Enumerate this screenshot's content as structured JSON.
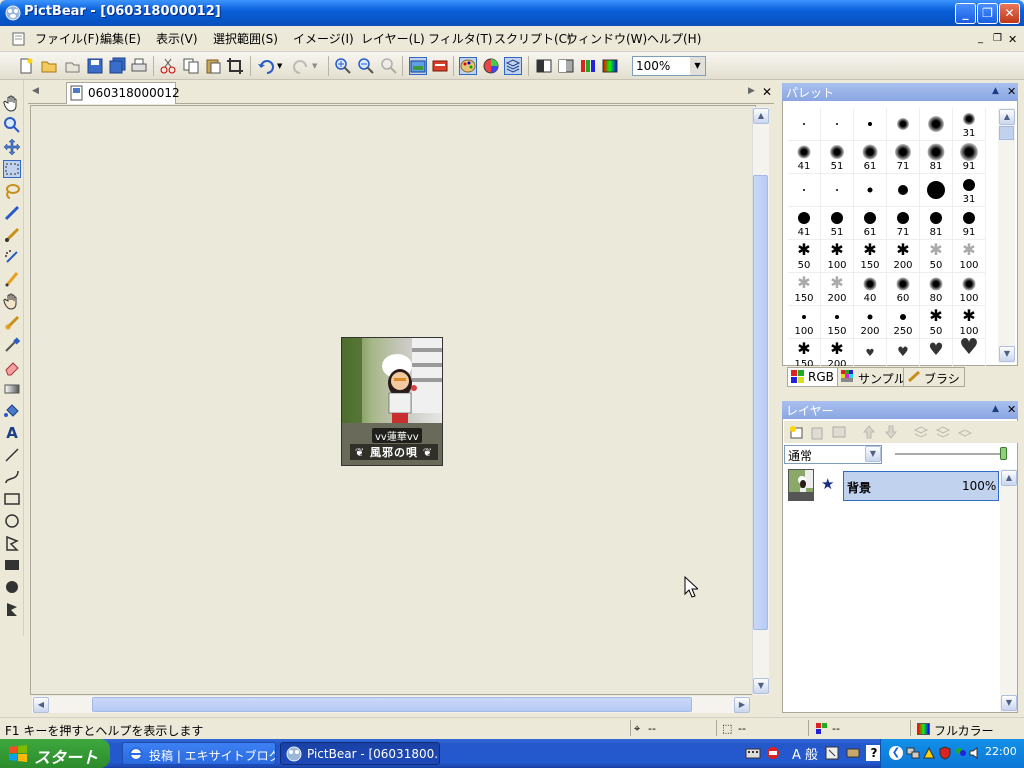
{
  "window": {
    "title": "PictBear - [060318000012]"
  },
  "menu": [
    "ファイル(F)",
    "編集(E)",
    "表示(V)",
    "選択範囲(S)",
    "イメージ(I)",
    "レイヤー(L)",
    "フィルタ(T)",
    "スクリプト(C)",
    "ウィンドウ(W)",
    "ヘルプ(H)"
  ],
  "toolbar": {
    "zoom": "100%"
  },
  "document": {
    "tab": "060318000012"
  },
  "image": {
    "name_tag": "vv蓮華vv",
    "guild_tag": "風邪の唄"
  },
  "palette": {
    "title": "パレット",
    "brushes": [
      {
        "label": "",
        "shape": "dot"
      },
      {
        "label": "",
        "shape": "dot"
      },
      {
        "label": "",
        "shape": "dot"
      },
      {
        "label": "",
        "shape": "soft"
      },
      {
        "label": "",
        "shape": "soft"
      },
      {
        "label": "31",
        "shape": "soft"
      },
      {
        "label": "41",
        "shape": "soft"
      },
      {
        "label": "51",
        "shape": "soft"
      },
      {
        "label": "61",
        "shape": "soft"
      },
      {
        "label": "71",
        "shape": "soft"
      },
      {
        "label": "81",
        "shape": "soft"
      },
      {
        "label": "91",
        "shape": "soft"
      },
      {
        "label": "",
        "shape": "dot"
      },
      {
        "label": "",
        "shape": "dot"
      },
      {
        "label": "",
        "shape": "dot"
      },
      {
        "label": "",
        "shape": "dot"
      },
      {
        "label": "",
        "shape": "dot"
      },
      {
        "label": "31",
        "shape": "dot"
      },
      {
        "label": "41",
        "shape": "dot"
      },
      {
        "label": "51",
        "shape": "dot"
      },
      {
        "label": "61",
        "shape": "dot"
      },
      {
        "label": "71",
        "shape": "dot"
      },
      {
        "label": "81",
        "shape": "dot"
      },
      {
        "label": "91",
        "shape": "dot"
      },
      {
        "label": "50",
        "shape": "star"
      },
      {
        "label": "100",
        "shape": "star"
      },
      {
        "label": "150",
        "shape": "star"
      },
      {
        "label": "200",
        "shape": "star"
      },
      {
        "label": "50",
        "shape": "starlight"
      },
      {
        "label": "100",
        "shape": "starlight"
      },
      {
        "label": "150",
        "shape": "starlight"
      },
      {
        "label": "200",
        "shape": "starlight"
      },
      {
        "label": "40",
        "shape": "soft"
      },
      {
        "label": "60",
        "shape": "soft"
      },
      {
        "label": "80",
        "shape": "soft"
      },
      {
        "label": "100",
        "shape": "soft"
      },
      {
        "label": "100",
        "shape": "dot"
      },
      {
        "label": "150",
        "shape": "dot"
      },
      {
        "label": "200",
        "shape": "dot"
      },
      {
        "label": "250",
        "shape": "dot"
      },
      {
        "label": "50",
        "shape": "star"
      },
      {
        "label": "100",
        "shape": "star"
      },
      {
        "label": "150",
        "shape": "star"
      },
      {
        "label": "200",
        "shape": "star"
      },
      {
        "label": "",
        "shape": "heart"
      },
      {
        "label": "",
        "shape": "heart"
      },
      {
        "label": "",
        "shape": "heart"
      },
      {
        "label": "",
        "shape": "heart"
      }
    ],
    "tabs": [
      "RGB",
      "サンプル",
      "ブラシ"
    ]
  },
  "layers": {
    "title": "レイヤー",
    "blend_mode": "通常",
    "items": [
      {
        "name": "背景",
        "opacity": "100%"
      }
    ]
  },
  "status": {
    "help": "F1 キーを押すとヘルプを表示します",
    "pos": "--",
    "size": "--",
    "color_val": "--",
    "mode": "フルカラー"
  },
  "taskbar": {
    "start": "スタート",
    "tasks": [
      "投稿 | エキサイトブログ...",
      "PictBear - [06031800..."
    ],
    "clock": "22:00",
    "ime": "A 般"
  },
  "colors": {
    "title_bar": "#0a5fd8",
    "selection": "#c1d2ee"
  }
}
